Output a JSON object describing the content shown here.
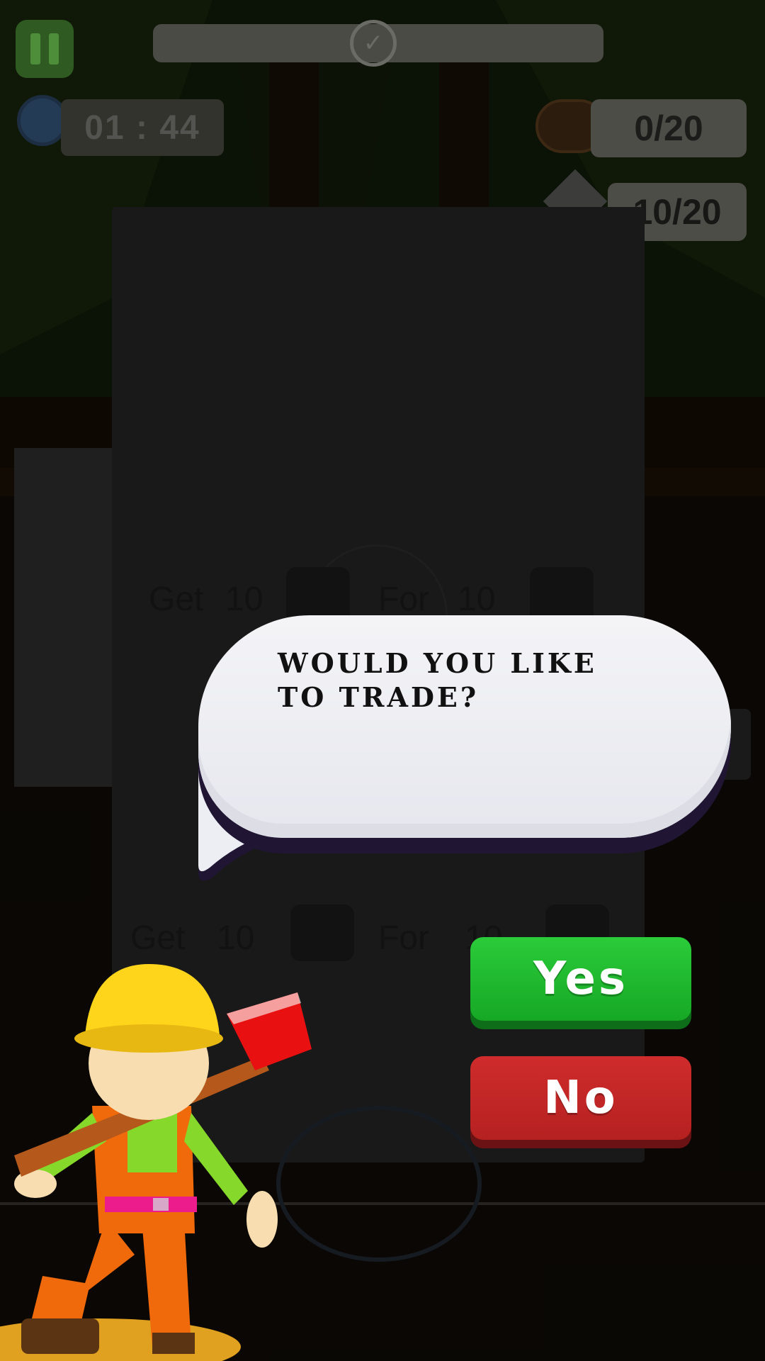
{
  "hud": {
    "timer": "01 : 44",
    "wood_count": "0/20",
    "stone_count": "10/20"
  },
  "shop": {
    "offers": [
      {
        "get_label": "Get",
        "get_amount": "10",
        "get_icon": "wood-log-icon",
        "for_label": "For",
        "for_amount": "10",
        "for_icon": "stone-icon"
      },
      {
        "get_label": "Get",
        "get_amount": "10",
        "get_icon": "stone-icon",
        "for_label": "For",
        "for_amount": "10",
        "for_icon": "wood-log-icon"
      }
    ]
  },
  "dialog": {
    "question": "WOULD YOU LIKE\nTO TRADE?",
    "yes_label": "Yes",
    "no_label": "No"
  },
  "colors": {
    "yes_button": "#22bb30",
    "no_button": "#c42828",
    "bubble": "#eeeff4"
  }
}
